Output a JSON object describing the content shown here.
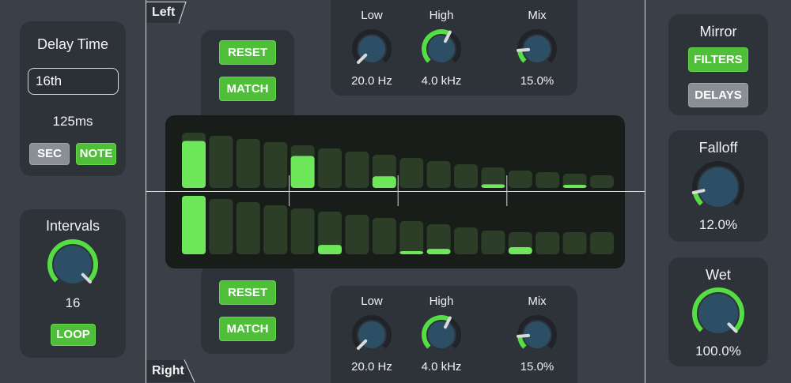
{
  "delay_panel": {
    "title": "Delay Time",
    "dropdown_value": "16th",
    "time_value": "125ms",
    "sec_label": "SEC",
    "note_label": "NOTE"
  },
  "intervals_panel": {
    "title": "Intervals",
    "value": "16",
    "loop_label": "LOOP",
    "knob_level": 1.0
  },
  "left_channel": {
    "tab_label": "Left",
    "reset_label": "RESET",
    "match_label": "MATCH",
    "knobs": [
      {
        "label": "Low",
        "value": "20.0 Hz",
        "level": 0.0
      },
      {
        "label": "High",
        "value": "4.0 kHz",
        "level": 0.6
      },
      {
        "label": "Mix",
        "value": "15.0%",
        "level": 0.15
      }
    ],
    "steps": [
      0.85,
      0,
      0,
      0,
      0.75,
      0,
      0,
      0.35,
      0,
      0,
      0,
      0.18,
      0,
      0,
      0.08,
      0
    ]
  },
  "right_channel": {
    "tab_label": "Right",
    "reset_label": "RESET",
    "match_label": "MATCH",
    "knobs": [
      {
        "label": "Low",
        "value": "20.0 Hz",
        "level": 0.0
      },
      {
        "label": "High",
        "value": "4.0 kHz",
        "level": 0.6
      },
      {
        "label": "Mix",
        "value": "15.0%",
        "level": 0.15
      }
    ],
    "steps": [
      1.0,
      0,
      0,
      0,
      0,
      0.22,
      0,
      0,
      0.08,
      0.18,
      0,
      0,
      0.32,
      0,
      0,
      0
    ]
  },
  "mirror_panel": {
    "title": "Mirror",
    "filters_label": "FILTERS",
    "delays_label": "DELAYS"
  },
  "falloff_panel": {
    "title": "Falloff",
    "value": "12.0%",
    "knob_level": 0.12
  },
  "wet_panel": {
    "title": "Wet",
    "value": "100.0%",
    "knob_level": 1.0
  },
  "colors": {
    "accent_green": "#55dd44",
    "knob_body": "#2d4f66",
    "panel_bg": "#2e333a"
  }
}
